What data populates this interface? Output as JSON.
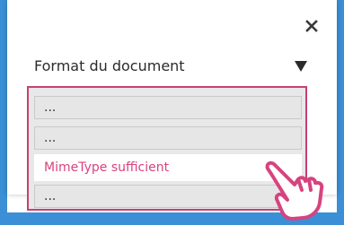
{
  "dialog": {
    "close_glyph": "×",
    "field_label": "Format du document",
    "caret_glyph": "▼"
  },
  "list": {
    "options": [
      "...",
      "...",
      "MimeType sufficient",
      "..."
    ],
    "highlighted_index": 2
  },
  "colors": {
    "accent": "#d7437f",
    "list_border": "#c93f74",
    "background_blue": "#3b8fd6"
  },
  "icons": {
    "close": "close-icon",
    "caret": "caret-down-icon",
    "pointer": "hand-pointer-icon"
  }
}
